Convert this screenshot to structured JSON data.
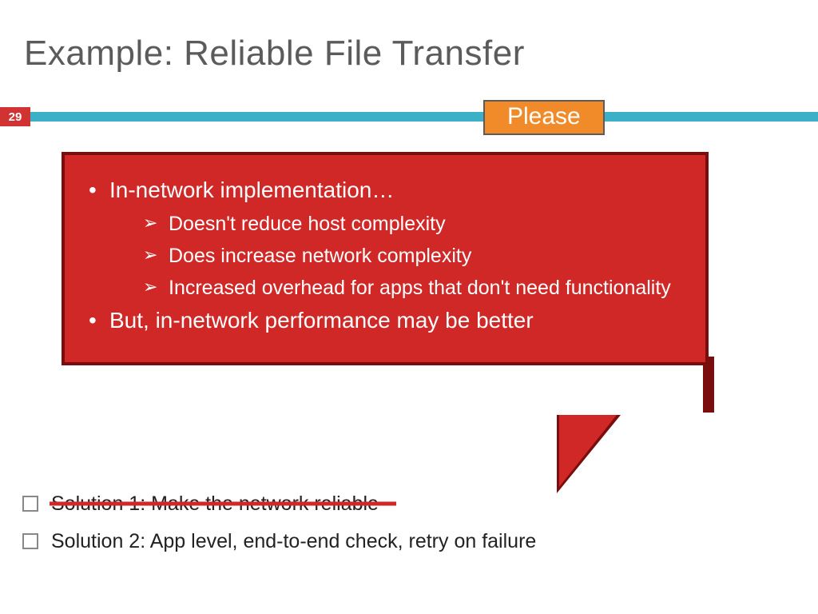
{
  "title": "Example: Reliable File Transfer",
  "page_number": "29",
  "tag": "Please",
  "bubble": {
    "point1": "In-network implementation…",
    "sub": [
      "Doesn't reduce host complexity",
      "Does increase network complexity",
      "Increased overhead for apps that don't need functionality"
    ],
    "point2": "But, in-network performance may be better"
  },
  "solutions": {
    "s1": "Solution 1: Make the network reliable",
    "s2": "Solution 2: App level, end-to-end check, retry on failure"
  }
}
